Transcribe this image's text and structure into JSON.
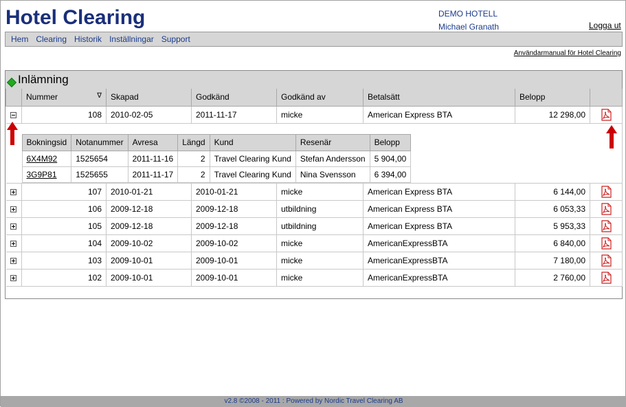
{
  "app_title": "Hotel Clearing",
  "hotel": {
    "name": "DEMO HOTELL",
    "user": "Michael Granath"
  },
  "logout_label": "Logga ut",
  "menu": [
    "Hem",
    "Clearing",
    "Historik",
    "Inställningar",
    "Support"
  ],
  "manual_link": "Användarmanual för Hotel Clearing",
  "panel_title": "Inlämning",
  "columns": [
    "Nummer",
    "Skapad",
    "Godkänd",
    "Godkänd av",
    "Betalsätt",
    "Belopp"
  ],
  "sort_indicator": "∇",
  "rows": [
    {
      "nummer": "108",
      "skapad": "2010-02-05",
      "godkand": "2011-11-17",
      "godkand_av": "micke",
      "betalsatt": "American Express BTA",
      "belopp": "12 298,00",
      "expanded": true
    },
    {
      "nummer": "107",
      "skapad": "2010-01-21",
      "godkand": "2010-01-21",
      "godkand_av": "micke",
      "betalsatt": "American Express BTA",
      "belopp": "6 144,00"
    },
    {
      "nummer": "106",
      "skapad": "2009-12-18",
      "godkand": "2009-12-18",
      "godkand_av": "utbildning",
      "betalsatt": "American Express BTA",
      "belopp": "6 053,33"
    },
    {
      "nummer": "105",
      "skapad": "2009-12-18",
      "godkand": "2009-12-18",
      "godkand_av": "utbildning",
      "betalsatt": "American Express BTA",
      "belopp": "5 953,33"
    },
    {
      "nummer": "104",
      "skapad": "2009-10-02",
      "godkand": "2009-10-02",
      "godkand_av": "micke",
      "betalsatt": "AmericanExpressBTA",
      "belopp": "6 840,00"
    },
    {
      "nummer": "103",
      "skapad": "2009-10-01",
      "godkand": "2009-10-01",
      "godkand_av": "micke",
      "betalsatt": "AmericanExpressBTA",
      "belopp": "7 180,00"
    },
    {
      "nummer": "102",
      "skapad": "2009-10-01",
      "godkand": "2009-10-01",
      "godkand_av": "micke",
      "betalsatt": "AmericanExpressBTA",
      "belopp": "2 760,00"
    }
  ],
  "sub_columns": [
    "Bokningsid",
    "Notanummer",
    "Avresa",
    "Längd",
    "Kund",
    "Resenär",
    "Belopp"
  ],
  "sub_rows": [
    {
      "bokningsid": "6X4M92",
      "notanummer": "1525654",
      "avresa": "2011-11-16",
      "langd": "2",
      "kund": "Travel Clearing Kund",
      "resenar": "Stefan Andersson",
      "belopp": "5 904,00"
    },
    {
      "bokningsid": "3G9P81",
      "notanummer": "1525655",
      "avresa": "2011-11-17",
      "langd": "2",
      "kund": "Travel Clearing Kund",
      "resenar": "Nina Svensson",
      "belopp": "6 394,00"
    }
  ],
  "footer": "v2.8 ©2008 - 2011 : Powered by Nordic Travel Clearing AB",
  "colors": {
    "title": "#1a2f7a",
    "link": "#1a3a8a",
    "header_bg": "#d6d6d6",
    "arrow": "#cc0000",
    "pdf": "#cc2222"
  },
  "icons": {
    "toggle_expanded": "minus-box-icon",
    "toggle_collapsed": "plus-box-icon",
    "row_action": "pdf-icon",
    "panel_marker": "green-diamond-icon",
    "annotation": "red-arrow-icon"
  }
}
